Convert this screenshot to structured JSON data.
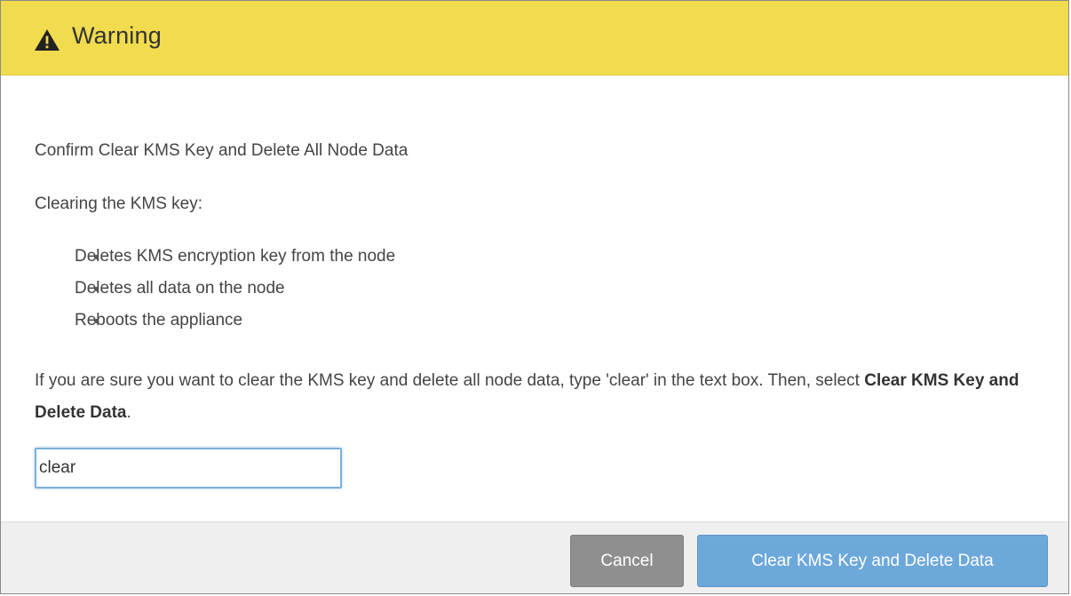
{
  "header": {
    "icon": "warning-triangle-icon",
    "title": "Warning",
    "background_color": "#f1db4e"
  },
  "body": {
    "subtitle": "Confirm Clear KMS Key and Delete All Node Data",
    "lead": "Clearing the KMS key:",
    "bullets": [
      "Deletes KMS encryption key from the node",
      "Deletes all data on the node",
      "Reboots the appliance"
    ],
    "instruction_prefix": "If you are sure you want to clear the KMS key and delete all node data, type 'clear' in the text box. Then, select ",
    "instruction_bold": "Clear KMS Key and Delete Data",
    "instruction_suffix": ".",
    "confirm_input_value": "clear"
  },
  "footer": {
    "cancel_label": "Cancel",
    "confirm_label": "Clear KMS Key and Delete Data",
    "cancel_color": "#8f8f8f",
    "confirm_color": "#6da8db"
  }
}
